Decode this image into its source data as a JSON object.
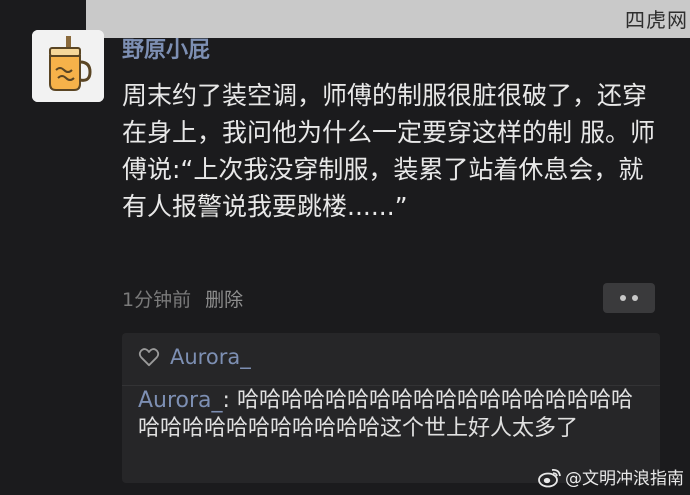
{
  "watermark_top": "四虎网",
  "post": {
    "username": "野原小屁",
    "text": "周末约了装空调，师傅的制服很脏很破了，还穿在身上，我问他为什么一定要穿这样的制 服。师傅说:“上次我没穿制服，装累了站着休息会，就有人报警说我要跳楼......”",
    "time": "1分钟前",
    "delete_label": "删除"
  },
  "comment_box": {
    "liker": "Aurora_",
    "comment_author": "Aurora_",
    "comment_separator": ":",
    "comment_text": " 哈哈哈哈哈哈哈哈哈哈哈哈哈哈哈哈哈哈哈哈哈哈哈哈哈哈哈哈哈这个世上好人太多了"
  },
  "watermark_bottom": "@文明冲浪指南",
  "colors": {
    "background": "#1b1b1d",
    "name_link": "#7d8fb3",
    "text": "#e8e8e8",
    "meta": "#7a7a7a",
    "comment_bg": "#262628"
  }
}
